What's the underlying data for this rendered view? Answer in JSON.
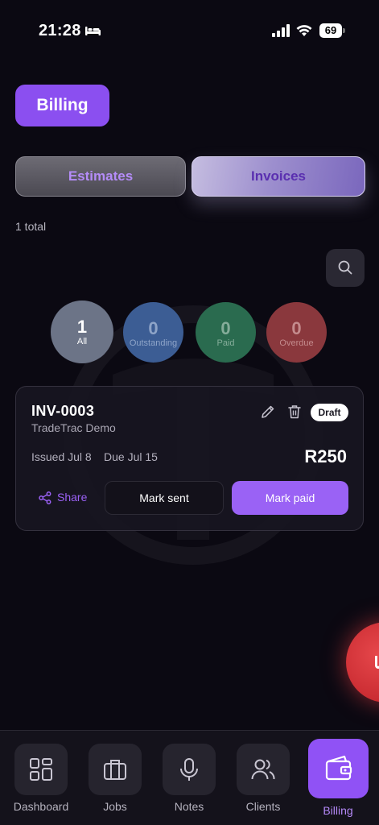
{
  "status_bar": {
    "time": "21:28",
    "battery": "69",
    "icons": [
      "bed-icon",
      "signal-icon",
      "wifi-icon",
      "battery-icon"
    ]
  },
  "header": {
    "title": "Billing"
  },
  "tabs": [
    {
      "label": "Estimates",
      "active": false
    },
    {
      "label": "Invoices",
      "active": true
    }
  ],
  "summary": {
    "total": "1 total"
  },
  "filters": [
    {
      "count": "1",
      "label": "All",
      "active": true
    },
    {
      "count": "0",
      "label": "Outstanding",
      "active": false
    },
    {
      "count": "0",
      "label": "Paid",
      "active": false
    },
    {
      "count": "0",
      "label": "Overdue",
      "active": false
    }
  ],
  "invoice": {
    "number": "INV-0003",
    "client": "TradeTrac Demo",
    "status": "Draft",
    "issued": "Issued Jul 8",
    "due": "Due Jul 15",
    "amount": "R250",
    "actions": {
      "share": "Share",
      "mark_sent": "Mark sent",
      "mark_paid": "Mark paid"
    }
  },
  "nav": [
    {
      "label": "Dashboard",
      "icon": "grid-icon",
      "active": false
    },
    {
      "label": "Jobs",
      "icon": "briefcase-icon",
      "active": false
    },
    {
      "label": "Notes",
      "icon": "microphone-icon",
      "active": false
    },
    {
      "label": "Clients",
      "icon": "users-icon",
      "active": false
    },
    {
      "label": "Billing",
      "icon": "wallet-icon",
      "active": true
    }
  ],
  "colors": {
    "background": "#0b0912",
    "accent": "#8b4ff0",
    "outstanding": "#3c5d94",
    "paid": "#2a6b4f",
    "overdue": "#8a383d",
    "fab": "#d1333a"
  }
}
